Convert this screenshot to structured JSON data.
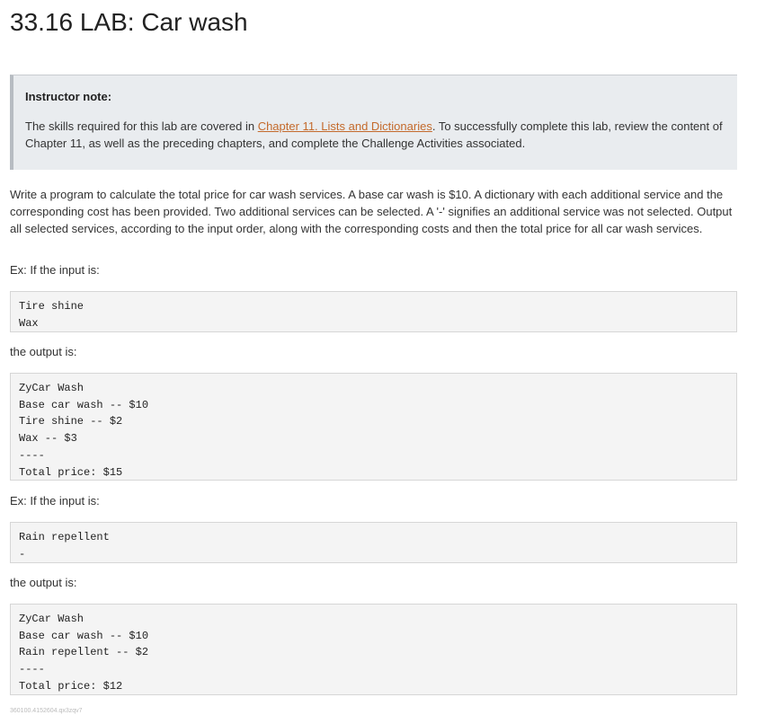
{
  "title": "33.16 LAB: Car wash",
  "instructor_note": {
    "label": "Instructor note:",
    "text_before_link": "The skills required for this lab are covered in ",
    "link_text": "Chapter 11. Lists and Dictionaries",
    "text_after_link": ". To successfully complete this lab, review the content of Chapter 11, as well as the preceding chapters, and complete the Challenge Activities associated."
  },
  "description": "Write a program to calculate the total price for car wash services. A base car wash is $10. A dictionary with each additional service and the corresponding cost has been provided. Two additional services can be selected. A '-' signifies an additional service was not selected. Output all selected services, according to the input order, along with the corresponding costs and then the total price for all car wash services.",
  "example1": {
    "input_label": "Ex: If the input is:",
    "input_lines": [
      "Tire shine",
      "Wax"
    ],
    "output_label": "the output is:",
    "output_lines": [
      "ZyCar Wash",
      "Base car wash -- $10",
      "Tire shine -- $2",
      "Wax -- $3",
      "----",
      "Total price: $15"
    ]
  },
  "example2": {
    "input_label": "Ex: If the input is:",
    "input_lines": [
      "Rain repellent",
      "-"
    ],
    "output_label": "the output is:",
    "output_lines": [
      "ZyCar Wash",
      "Base car wash -- $10",
      "Rain repellent -- $2",
      "----",
      "Total price: $12"
    ]
  },
  "footer_id": "360100.4152604.qx3zqv7",
  "colors": {
    "link": "#c46a2c",
    "note_background": "#e9ecef",
    "code_background": "#f4f4f4"
  }
}
